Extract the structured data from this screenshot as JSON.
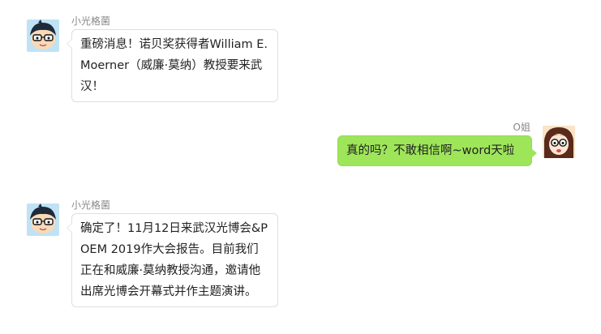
{
  "messages": [
    {
      "sender": "小光格菌",
      "side": "left",
      "avatar_icon": "cartoon-boy-glasses-icon",
      "text": "重磅消息！诺贝奖获得者William E. Moerner（威廉·莫纳）教授要来武汉！"
    },
    {
      "sender": "O姐",
      "side": "right",
      "avatar_icon": "cartoon-girl-glasses-icon",
      "text": "真的吗？不敢相信啊~word天啦"
    },
    {
      "sender": "小光格菌",
      "side": "left",
      "avatar_icon": "cartoon-boy-glasses-icon",
      "text": "确定了！11月12日来武汉光博会&POEM 2019作大会报告。目前我们正在和威廉·莫纳教授沟通，邀请他出席光博会开幕式并作主题演讲。"
    }
  ],
  "colors": {
    "incoming_bubble": "#ffffff",
    "outgoing_bubble": "#9ee55a",
    "sender_text": "#888888"
  }
}
